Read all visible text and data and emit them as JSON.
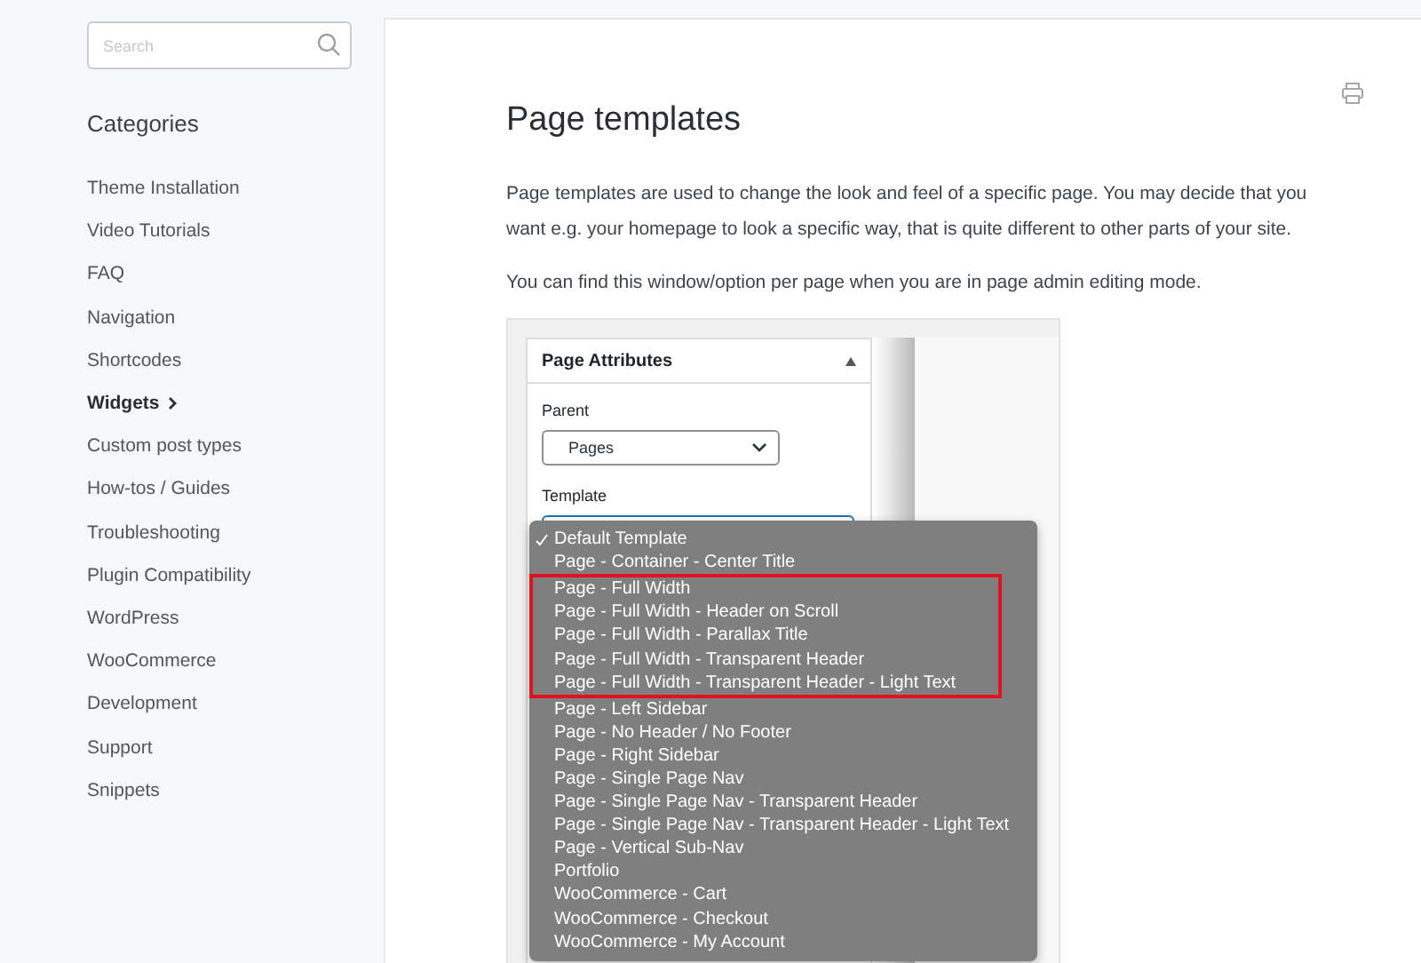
{
  "sidebar": {
    "search": {
      "placeholder": "Search"
    },
    "heading": "Categories",
    "items": [
      {
        "label": "Theme Installation",
        "selected": false
      },
      {
        "label": "Video Tutorials",
        "selected": false
      },
      {
        "label": "FAQ",
        "selected": false
      },
      {
        "label": "Navigation",
        "selected": false
      },
      {
        "label": "Shortcodes",
        "selected": false
      },
      {
        "label": "Widgets",
        "selected": true
      },
      {
        "label": "Custom post types",
        "selected": false
      },
      {
        "label": "How-tos / Guides",
        "selected": false
      },
      {
        "label": "Troubleshooting",
        "selected": false
      },
      {
        "label": "Plugin Compatibility",
        "selected": false
      },
      {
        "label": "WordPress",
        "selected": false
      },
      {
        "label": "WooCommerce",
        "selected": false
      },
      {
        "label": "Development",
        "selected": false
      },
      {
        "label": "Support",
        "selected": false
      },
      {
        "label": "Snippets",
        "selected": false
      }
    ]
  },
  "article": {
    "title": "Page templates",
    "paragraphs": [
      "Page templates are used to change the look and feel of a specific page. You may decide that you want e.g. your homepage to look a specific way, that is quite different to other parts of your site.",
      "You can find this window/option per page when you are in page admin editing mode."
    ],
    "screenshot": {
      "panel_title": "Page Attributes",
      "parent_label": "Parent",
      "parent_value": "Pages",
      "template_label": "Template",
      "options": [
        {
          "label": "Default Template",
          "selected": true,
          "highlighted": false
        },
        {
          "label": "Page - Container - Center Title",
          "selected": false,
          "highlighted": false
        },
        {
          "label": "Page - Full Width",
          "selected": false,
          "highlighted": true
        },
        {
          "label": "Page - Full Width - Header on Scroll",
          "selected": false,
          "highlighted": true
        },
        {
          "label": "Page - Full Width - Parallax Title",
          "selected": false,
          "highlighted": true
        },
        {
          "label": "Page - Full Width - Transparent Header",
          "selected": false,
          "highlighted": true
        },
        {
          "label": "Page - Full Width - Transparent Header - Light Text",
          "selected": false,
          "highlighted": true
        },
        {
          "label": "Page - Left Sidebar",
          "selected": false,
          "highlighted": false
        },
        {
          "label": "Page - No Header / No Footer",
          "selected": false,
          "highlighted": false
        },
        {
          "label": "Page - Right Sidebar",
          "selected": false,
          "highlighted": false
        },
        {
          "label": "Page - Single Page Nav",
          "selected": false,
          "highlighted": false
        },
        {
          "label": "Page - Single Page Nav - Transparent Header",
          "selected": false,
          "highlighted": false
        },
        {
          "label": "Page - Single Page Nav - Transparent Header - Light Text",
          "selected": false,
          "highlighted": false
        },
        {
          "label": "Page - Vertical Sub-Nav",
          "selected": false,
          "highlighted": false
        },
        {
          "label": "Portfolio",
          "selected": false,
          "highlighted": false
        },
        {
          "label": "WooCommerce - Cart",
          "selected": false,
          "highlighted": false
        },
        {
          "label": "WooCommerce - Checkout",
          "selected": false,
          "highlighted": false
        },
        {
          "label": "WooCommerce - My Account",
          "selected": false,
          "highlighted": false
        }
      ]
    }
  }
}
